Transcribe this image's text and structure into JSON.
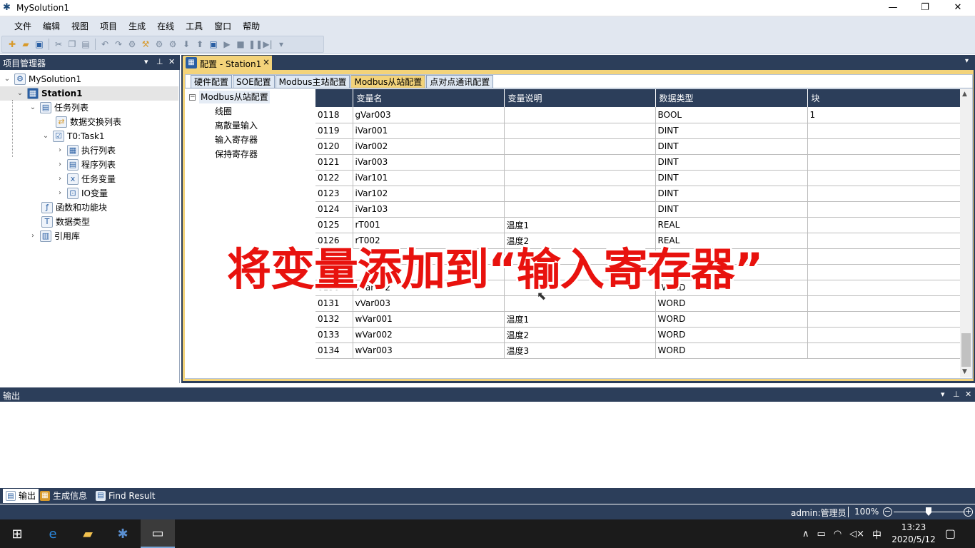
{
  "window": {
    "title": "MySolution1",
    "app_icon": "app-logo-icon",
    "controls": [
      "minimize-icon",
      "restore-icon",
      "close-icon"
    ]
  },
  "menu": [
    "文件",
    "编辑",
    "视图",
    "项目",
    "生成",
    "在线",
    "工具",
    "窗口",
    "帮助"
  ],
  "project_manager": {
    "title": "项目管理器",
    "nodes": [
      {
        "label": "MySolution1"
      },
      {
        "label": "Station1"
      },
      {
        "label": "任务列表"
      },
      {
        "label": "数据交换列表"
      },
      {
        "label": "T0:Task1"
      },
      {
        "label": "执行列表"
      },
      {
        "label": "程序列表"
      },
      {
        "label": "任务变量"
      },
      {
        "label": "IO变量"
      },
      {
        "label": "函数和功能块"
      },
      {
        "label": "数据类型"
      },
      {
        "label": "引用库"
      }
    ]
  },
  "document_tab": {
    "title": "配置 - Station1",
    "close": "×"
  },
  "subtabs": [
    "硬件配置",
    "SOE配置",
    "Modbus主站配置",
    "Modbus从站配置",
    "点对点通讯配置"
  ],
  "active_subtab": "Modbus从站配置",
  "config_tree": {
    "root": "Modbus从站配置",
    "expander": "−",
    "children": [
      "线圈",
      "离散量输入",
      "输入寄存器",
      "保持寄存器"
    ]
  },
  "grid": {
    "columns": [
      "",
      "变量名",
      "变量说明",
      "数据类型",
      "块"
    ],
    "rows": [
      [
        "0118",
        "gVar003",
        "",
        "BOOL",
        "1"
      ],
      [
        "0119",
        "iVar001",
        "",
        "DINT",
        ""
      ],
      [
        "0120",
        "iVar002",
        "",
        "DINT",
        ""
      ],
      [
        "0121",
        "iVar003",
        "",
        "DINT",
        ""
      ],
      [
        "0122",
        "iVar101",
        "",
        "DINT",
        ""
      ],
      [
        "0123",
        "iVar102",
        "",
        "DINT",
        ""
      ],
      [
        "0124",
        "iVar103",
        "",
        "DINT",
        ""
      ],
      [
        "0125",
        "rT001",
        "温度1",
        "REAL",
        ""
      ],
      [
        "0126",
        "rT002",
        "温度2",
        "REAL",
        ""
      ],
      [
        "",
        "",
        "",
        "",
        ""
      ],
      [
        "",
        "",
        "",
        "",
        ""
      ],
      [
        "0130",
        "vVar002",
        "",
        "WORD",
        ""
      ],
      [
        "0131",
        "vVar003",
        "",
        "WORD",
        ""
      ],
      [
        "0132",
        "wVar001",
        "温度1",
        "WORD",
        ""
      ],
      [
        "0133",
        "wVar002",
        "温度2",
        "WORD",
        ""
      ],
      [
        "0134",
        "wVar003",
        "温度3",
        "WORD",
        ""
      ]
    ]
  },
  "overlay_caption": "将变量添加到“输入寄存器”",
  "output_pane": {
    "title": "输出"
  },
  "bottom_tabs": [
    "输出",
    "生成信息",
    "Find Result"
  ],
  "status": {
    "user": "admin:管理员",
    "zoom": "100%",
    "zoom_minus": "−",
    "zoom_plus": "+"
  },
  "taskbar": {
    "time": "13:23",
    "date": "2020/5/12",
    "ime": "中"
  }
}
